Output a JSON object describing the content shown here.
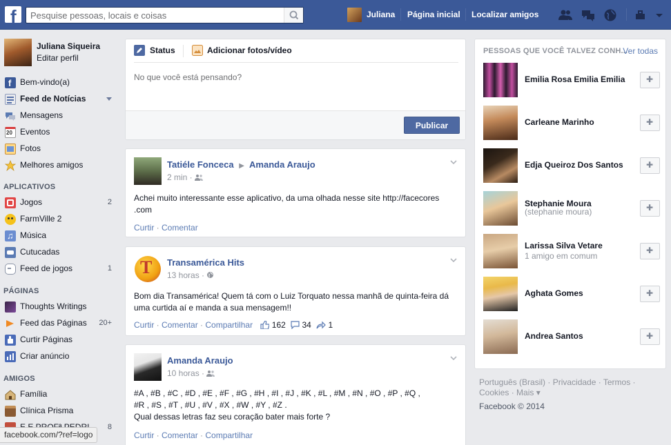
{
  "topbar": {
    "search_placeholder": "Pesquise pessoas, locais e coisas",
    "user_name": "Juliana",
    "home": "Página inicial",
    "find_friends": "Localizar amigos",
    "brand_color": "#3b5998"
  },
  "profile": {
    "name": "Juliana Siqueira",
    "edit": "Editar perfil"
  },
  "left_nav": {
    "favorites": [
      {
        "label": "Bem-vindo(a)",
        "icon": "facebook-icon"
      },
      {
        "label": "Feed de Notícias",
        "icon": "news-feed-icon"
      },
      {
        "label": "Mensagens",
        "icon": "messages-icon"
      },
      {
        "label": "Eventos",
        "icon": "calendar-icon",
        "icon_text": "20"
      },
      {
        "label": "Fotos",
        "icon": "photos-icon"
      },
      {
        "label": "Melhores amigos",
        "icon": "star-icon"
      }
    ],
    "apps_title": "APLICATIVOS",
    "apps": [
      {
        "label": "Jogos",
        "count": "2"
      },
      {
        "label": "FarmVille 2",
        "count": ""
      },
      {
        "label": "Música",
        "count": ""
      },
      {
        "label": "Cutucadas",
        "count": ""
      },
      {
        "label": "Feed de jogos",
        "count": "1"
      }
    ],
    "pages_title": "PÁGINAS",
    "pages": [
      {
        "label": "Thoughts Writings",
        "count": ""
      },
      {
        "label": "Feed das Páginas",
        "count": "20+"
      },
      {
        "label": "Curtir Páginas",
        "count": ""
      },
      {
        "label": "Criar anúncio",
        "count": ""
      }
    ],
    "friends_title": "AMIGOS",
    "friends": [
      {
        "label": "Família",
        "count": ""
      },
      {
        "label": "Clínica Prisma",
        "count": ""
      },
      {
        "label": "E.E PROFª PEDRI...",
        "count": "8"
      }
    ]
  },
  "browser_status": "facebook.com/?ref=logo",
  "composer": {
    "tab_status": "Status",
    "tab_photo": "Adicionar fotos/vídeo",
    "placeholder": "No que você está pensando?",
    "publish": "Publicar"
  },
  "posts": [
    {
      "author": "Tatiéle Fonceca",
      "target": "Amanda Araujo",
      "time": "2 min",
      "text": "Achei muito interessante esse aplicativo, da uma olhada nesse site http://facecores .com",
      "like": "Curtir",
      "comment": "Comentar"
    },
    {
      "author": "Transamérica Hits",
      "time": "13 horas",
      "text": "Bom dia Transamérica! Quem tá com o Luiz Torquato nessa manhã de quinta-feira dá uma curtida aí e manda a sua mensagem!!",
      "like": "Curtir",
      "comment": "Comentar",
      "share": "Compartilhar",
      "likes": "162",
      "comments": "34",
      "shares": "1"
    },
    {
      "author": "Amanda Araujo",
      "time": "10 horas",
      "text_line1": "#A , #B , #C , #D , #E , #F , #G , #H , #I , #J , #K , #L , #M , #N , #O , #P , #Q ,",
      "text_line2": "#R , #S , #T , #U , #V , #X , #W , #Y , #Z .",
      "text_line3": "Qual dessas letras faz seu coração bater mais forte ?",
      "like": "Curtir",
      "comment": "Comentar",
      "share": "Compartilhar"
    }
  ],
  "suggestions": {
    "title": "PESSOAS QUE VOCÊ TALVEZ CONH...",
    "see_all": "Ver todas",
    "people": [
      {
        "name": "Emilia Rosa Emilia Emilia",
        "sub": ""
      },
      {
        "name": "Carleane Marinho",
        "sub": ""
      },
      {
        "name": "Edja Queiroz Dos Santos",
        "sub": ""
      },
      {
        "name": "Stephanie Moura",
        "sub": "(stephanie moura)"
      },
      {
        "name": "Larissa Silva Vetare",
        "sub": "1 amigo em comum"
      },
      {
        "name": "Aghata Gomes",
        "sub": ""
      },
      {
        "name": "Andrea Santos",
        "sub": ""
      }
    ]
  },
  "footer": {
    "links": "Português (Brasil) · Privacidade · Termos · Cookies · Mais ▾",
    "copyright": "Facebook © 2014"
  }
}
